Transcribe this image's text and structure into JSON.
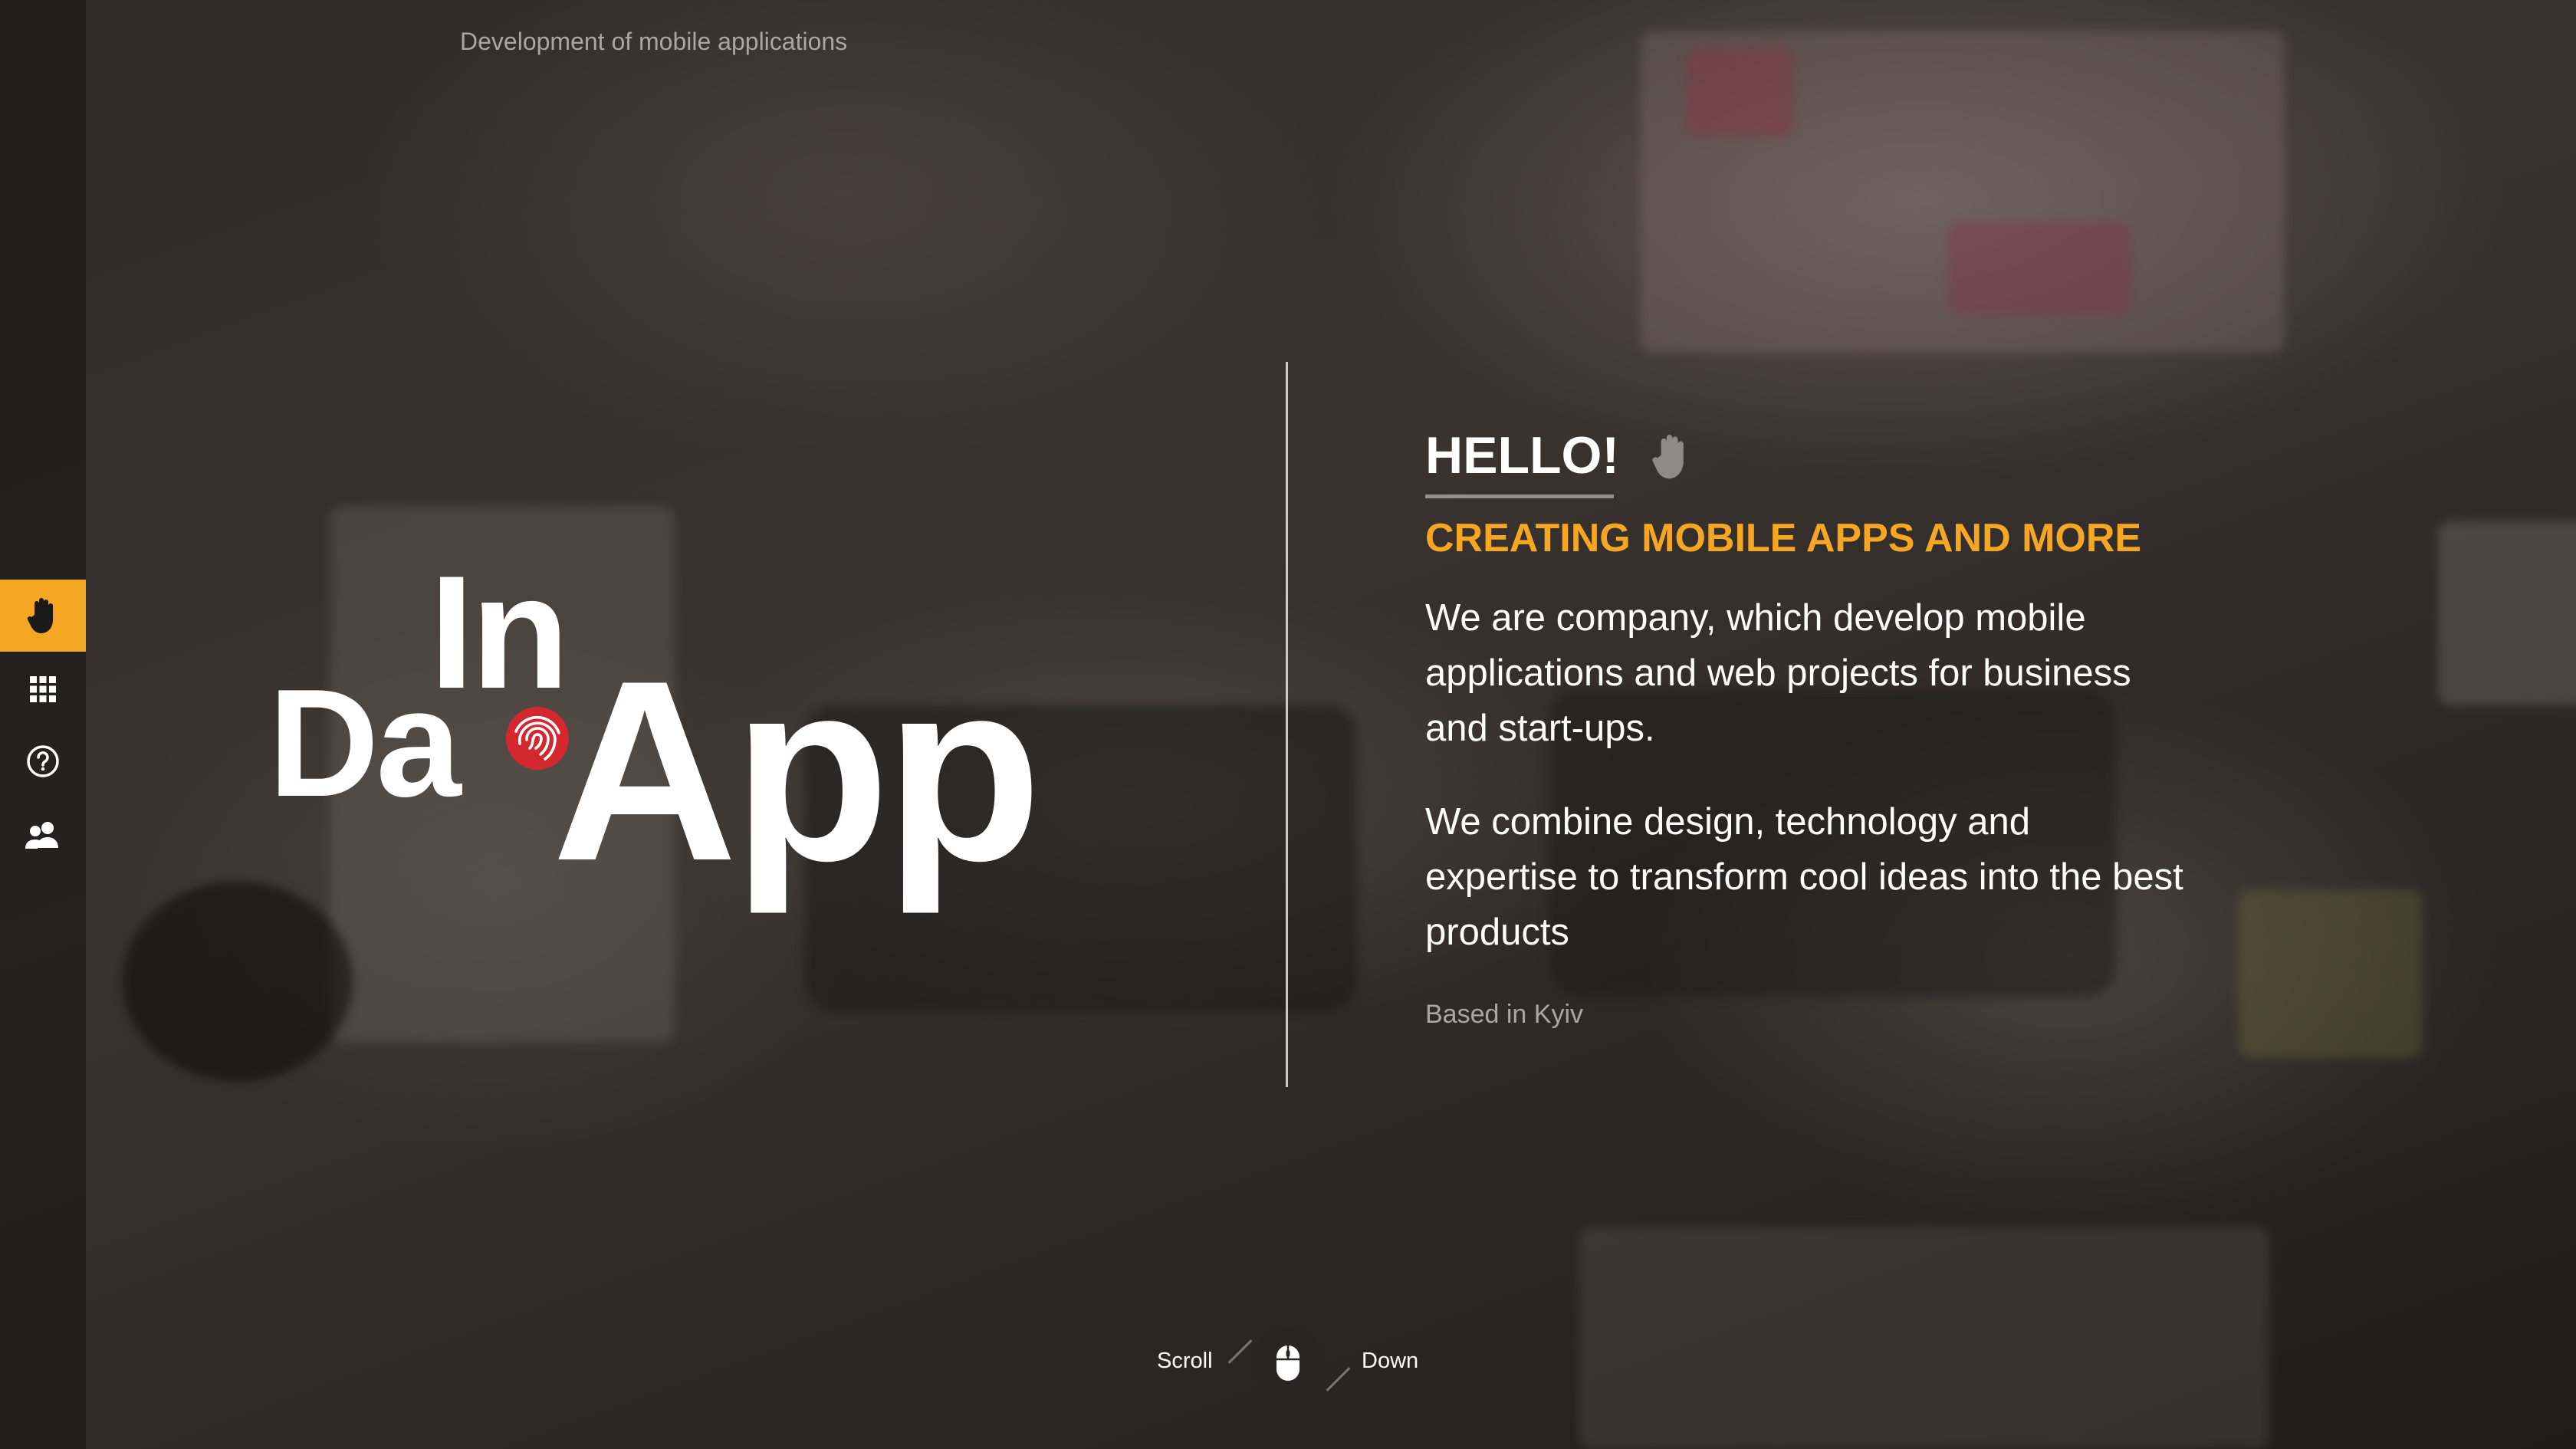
{
  "header": {
    "tagline": "Development of mobile applications"
  },
  "sidebar": {
    "items": [
      {
        "icon": "hand-icon",
        "active": true
      },
      {
        "icon": "grid-icon",
        "active": false
      },
      {
        "icon": "help-icon",
        "active": false
      },
      {
        "icon": "team-icon",
        "active": false
      }
    ]
  },
  "logo": {
    "word_top": "In",
    "word_left": "Da",
    "word_main": "App"
  },
  "intro": {
    "hello": "HELLO!",
    "subheading": "CREATING MOBILE APPS AND MORE",
    "paragraph1": "We are company, which develop mobile applications and web projects for business and start-ups.",
    "paragraph2": "We combine design, technology and expertise to transform cool ideas into the best products",
    "location": "Based in Kyiv"
  },
  "scroll": {
    "left_label": "Scroll",
    "right_label": "Down"
  },
  "colors": {
    "accent": "#f5a623",
    "text": "#ffffff",
    "muted": "#a9a7a5"
  }
}
